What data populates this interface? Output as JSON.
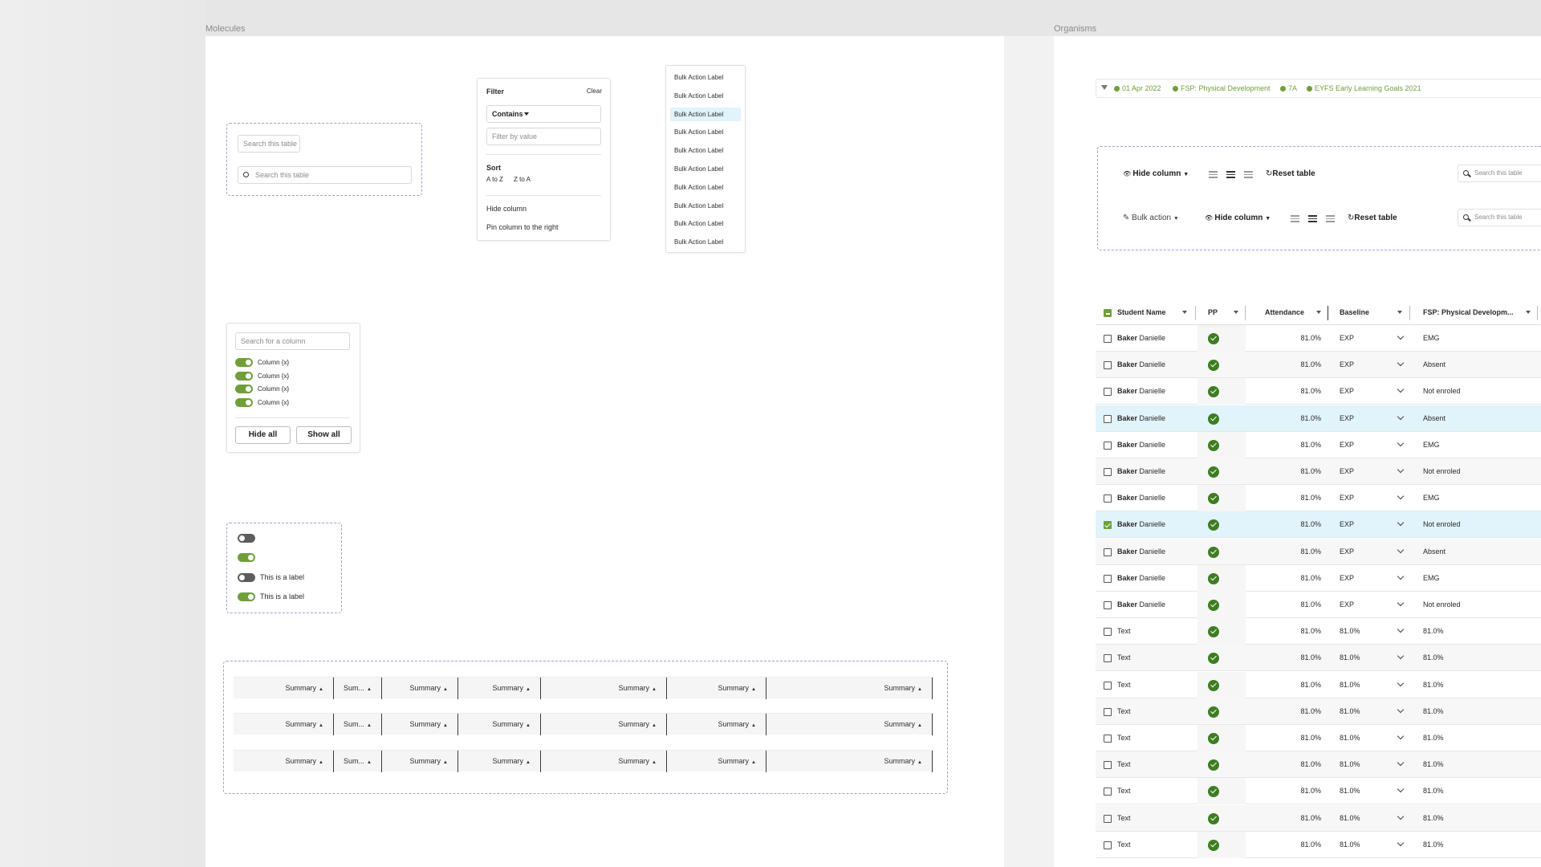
{
  "sections": {
    "molecules": "Molecules",
    "organisms": "Organisms"
  },
  "search": {
    "placeholder1": "Search this table",
    "placeholder2": "Search this table"
  },
  "filter": {
    "title": "Filter",
    "clear": "Clear",
    "operator": "Contains",
    "value_placeholder": "Filter by value",
    "sort_title": "Sort",
    "sort_az": "A to Z",
    "sort_za": "Z to A",
    "hide_column": "Hide column",
    "pin_column": "Pin column to the right"
  },
  "bulk_actions": {
    "items": [
      "Bulk Action Label",
      "Bulk Action Label",
      "Bulk Action Label",
      "Bulk Action Label",
      "Bulk Action Label",
      "Bulk Action Label",
      "Bulk Action Label",
      "Bulk Action Label",
      "Bulk Action Label",
      "Bulk Action Label"
    ],
    "selected_index": 2
  },
  "columns_panel": {
    "search_placeholder": "Search for a column",
    "columns": [
      "Column {x}",
      "Column {x}",
      "Column {x}",
      "Column {x}"
    ],
    "hide_all": "Hide all",
    "show_all": "Show all"
  },
  "toggles": {
    "label1": "This is a label",
    "label2": "This is a label"
  },
  "summary_rows": {
    "cells": [
      "Summary",
      "Sum...",
      "Summary",
      "Summary",
      "Summary",
      "Summary",
      "Summary"
    ]
  },
  "filter_chips": [
    "01 Apr 2022",
    "FSP: Physical Development",
    "7A",
    "EYFS Early Learning Goals 2021"
  ],
  "toolbar": {
    "hide_column": "Hide column",
    "reset_table": "Reset table",
    "bulk_action": "Bulk action",
    "search_placeholder": "Search this table"
  },
  "grid": {
    "headers": [
      "Student Name",
      "PP",
      "Attendance",
      "Baseline",
      "FSP: Physical Developm..."
    ],
    "rows": [
      {
        "last": "Baker",
        "first": "Danielle",
        "att": "81.0%",
        "base": "EXP",
        "fsp": "EMG",
        "state": "",
        "checked": false
      },
      {
        "last": "Baker",
        "first": "Danielle",
        "att": "81.0%",
        "base": "EXP",
        "fsp": "Absent",
        "state": "alt",
        "checked": false
      },
      {
        "last": "Baker",
        "first": "Danielle",
        "att": "81.0%",
        "base": "EXP",
        "fsp": "Not enroled",
        "state": "",
        "checked": false
      },
      {
        "last": "Baker",
        "first": "Danielle",
        "att": "81.0%",
        "base": "EXP",
        "fsp": "Absent",
        "state": "hl",
        "checked": false
      },
      {
        "last": "Baker",
        "first": "Danielle",
        "att": "81.0%",
        "base": "EXP",
        "fsp": "EMG",
        "state": "",
        "checked": false
      },
      {
        "last": "Baker",
        "first": "Danielle",
        "att": "81.0%",
        "base": "EXP",
        "fsp": "Not enroled",
        "state": "alt",
        "checked": false
      },
      {
        "last": "Baker",
        "first": "Danielle",
        "att": "81.0%",
        "base": "EXP",
        "fsp": "EMG",
        "state": "",
        "checked": false
      },
      {
        "last": "Baker",
        "first": "Danielle",
        "att": "81.0%",
        "base": "EXP",
        "fsp": "Not enroled",
        "state": "hl",
        "checked": true
      },
      {
        "last": "Baker",
        "first": "Danielle",
        "att": "81.0%",
        "base": "EXP",
        "fsp": "Absent",
        "state": "alt",
        "checked": false
      },
      {
        "last": "Baker",
        "first": "Danielle",
        "att": "81.0%",
        "base": "EXP",
        "fsp": "EMG",
        "state": "",
        "checked": false
      },
      {
        "last": "Baker",
        "first": "Danielle",
        "att": "81.0%",
        "base": "EXP",
        "fsp": "Not enroled",
        "state": "",
        "checked": false
      },
      {
        "last": "Text",
        "first": "",
        "att": "81.0%",
        "base": "81.0%",
        "fsp": "81.0%",
        "state": "",
        "checked": false
      },
      {
        "last": "Text",
        "first": "",
        "att": "81.0%",
        "base": "81.0%",
        "fsp": "81.0%",
        "state": "alt",
        "checked": false
      },
      {
        "last": "Text",
        "first": "",
        "att": "81.0%",
        "base": "81.0%",
        "fsp": "81.0%",
        "state": "",
        "checked": false
      },
      {
        "last": "Text",
        "first": "",
        "att": "81.0%",
        "base": "81.0%",
        "fsp": "81.0%",
        "state": "alt",
        "checked": false
      },
      {
        "last": "Text",
        "first": "",
        "att": "81.0%",
        "base": "81.0%",
        "fsp": "81.0%",
        "state": "",
        "checked": false
      },
      {
        "last": "Text",
        "first": "",
        "att": "81.0%",
        "base": "81.0%",
        "fsp": "81.0%",
        "state": "alt",
        "checked": false
      },
      {
        "last": "Text",
        "first": "",
        "att": "81.0%",
        "base": "81.0%",
        "fsp": "81.0%",
        "state": "",
        "checked": false
      },
      {
        "last": "Text",
        "first": "",
        "att": "81.0%",
        "base": "81.0%",
        "fsp": "81.0%",
        "state": "alt",
        "checked": false
      },
      {
        "last": "Text",
        "first": "",
        "att": "81.0%",
        "base": "81.0%",
        "fsp": "81.0%",
        "state": "",
        "checked": false
      }
    ]
  },
  "colors": {
    "accent": "#6f9f3a",
    "check": "#3e7d22",
    "highlight": "#e1f3fb",
    "dashed": "#a99bdc"
  }
}
